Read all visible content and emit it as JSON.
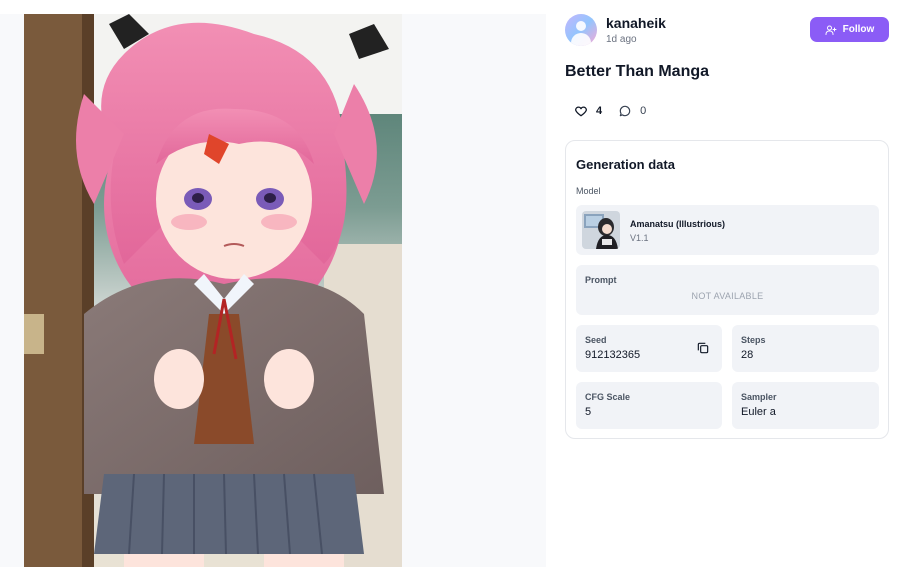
{
  "author": {
    "name": "kanaheik",
    "posted": "1d ago"
  },
  "follow_label": "Follow",
  "post_title": "Better Than Manga",
  "stats": {
    "likes": "4",
    "comments": "0"
  },
  "generation": {
    "title": "Generation data",
    "model_label": "Model",
    "model_name": "Amanatsu (Illustrious)",
    "model_version": "V1.1",
    "prompt_label": "Prompt",
    "prompt_value": "NOT AVAILABLE",
    "seed_label": "Seed",
    "seed_value": "912132365",
    "steps_label": "Steps",
    "steps_value": "28",
    "cfg_label": "CFG Scale",
    "cfg_value": "5",
    "sampler_label": "Sampler",
    "sampler_value": "Euler a"
  },
  "colors": {
    "accent": "#8b5cf6",
    "tile_bg": "#f1f3f7",
    "border": "#e5e7eb"
  }
}
